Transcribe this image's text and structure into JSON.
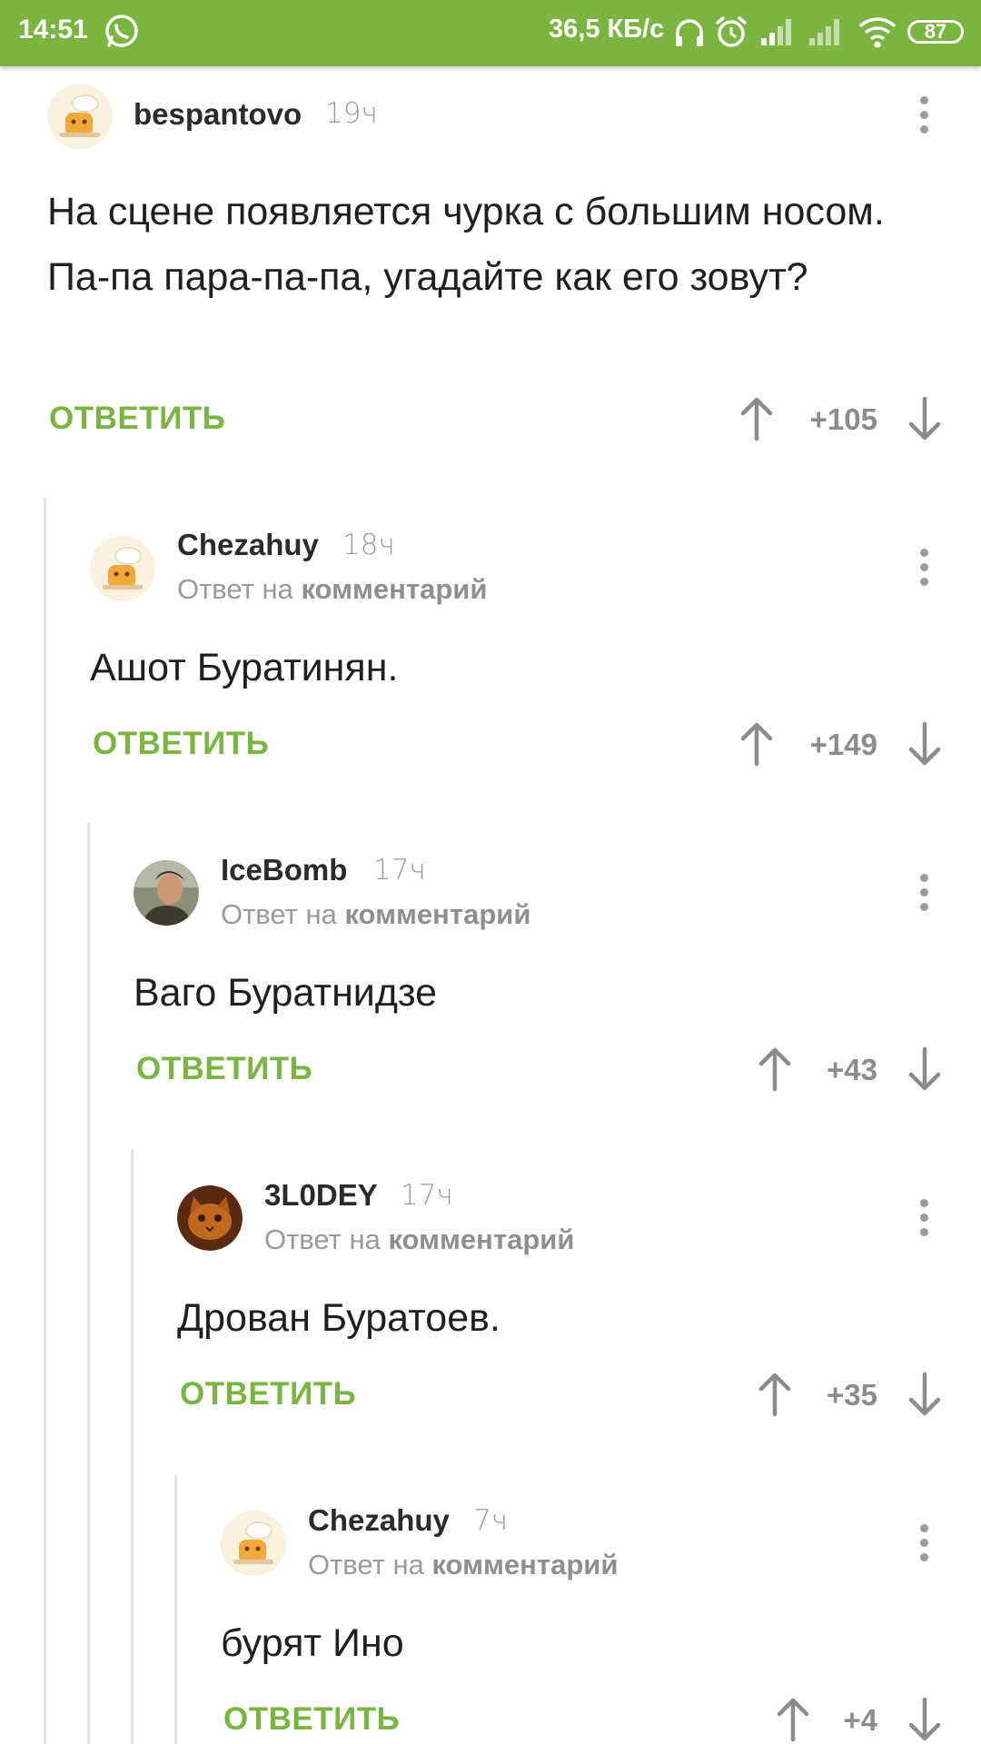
{
  "status_bar": {
    "time": "14:51",
    "net_speed": "36,5 КБ/с",
    "battery": "87",
    "icons": [
      "whatsapp-icon",
      "headphones-icon",
      "alarm-icon",
      "signal-icon",
      "signal-empty-icon",
      "wifi-icon",
      "battery-icon"
    ],
    "background": "#79b540"
  },
  "colors": {
    "accent": "#79b540",
    "text": "#1f1f1f",
    "muted": "#9a9a9a",
    "thread_line": "#e2e2e2"
  },
  "comments": [
    {
      "username": "bespantovo",
      "time": "19ч",
      "reply_prefix": "",
      "reply_link": "",
      "text": "На сцене появляется чурка с большим носом. Па-па пара-па-па, угадайте как его зовут?",
      "reply_label": "ОТВЕТИТЬ",
      "score": "+105",
      "avatar": "default-chef-avatar"
    },
    {
      "username": "Chezahuy",
      "time": "18ч",
      "reply_prefix": "Ответ на ",
      "reply_link": "комментарий",
      "text": "Ашот Буратинян.",
      "reply_label": "ОТВЕТИТЬ",
      "score": "+149",
      "avatar": "default-chef-avatar"
    },
    {
      "username": "IceBomb",
      "time": "17ч",
      "reply_prefix": "Ответ на ",
      "reply_link": "комментарий",
      "text": "Ваго Буратнидзе",
      "reply_label": "ОТВЕТИТЬ",
      "score": "+43",
      "avatar": "photo-avatar"
    },
    {
      "username": "3L0DEY",
      "time": "17ч",
      "reply_prefix": "Ответ на ",
      "reply_link": "комментарий",
      "text": "Дрован Буратоев.",
      "reply_label": "ОТВЕТИТЬ",
      "score": "+35",
      "avatar": "cat-photo-avatar"
    },
    {
      "username": "Chezahuy",
      "time": "7ч",
      "reply_prefix": "Ответ на ",
      "reply_link": "комментарий",
      "text": "бурят Ино",
      "reply_label": "ОТВЕТИТЬ",
      "score": "+4",
      "avatar": "default-chef-avatar"
    }
  ]
}
